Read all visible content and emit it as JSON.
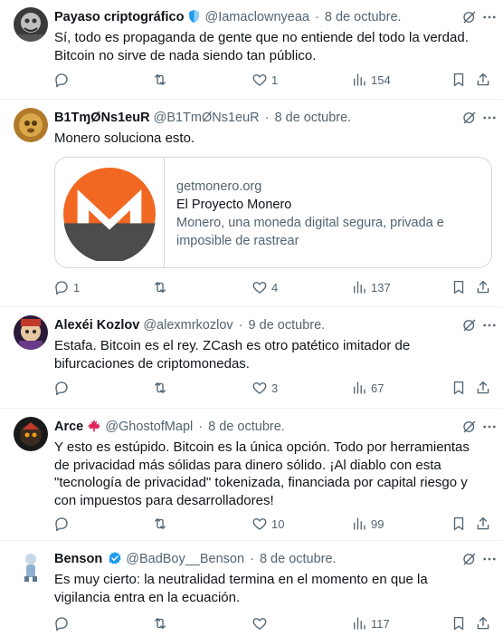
{
  "tweets": [
    {
      "name": "Payaso criptográfico",
      "handle": "@Iamaclownyeaa",
      "date": "8 de octubre.",
      "text": "Sí, todo es propaganda de gente que no entiende del todo la verdad. Bitcoin no sirve de nada siendo tan público.",
      "replies": "",
      "retweets": "",
      "likes": "1",
      "views": "154",
      "badge": "shield"
    },
    {
      "name": "B1TɱØNs1euR",
      "handle": "@B1TmØNs1euR",
      "date": "8 de octubre.",
      "text": "Monero soluciona esto.",
      "replies": "1",
      "retweets": "",
      "likes": "4",
      "views": "137",
      "card": {
        "domain": "getmonero.org",
        "title": "El Proyecto Monero",
        "description": "Monero, una moneda digital segura, privada e imposible de rastrear"
      }
    },
    {
      "name": "Alexéi Kozlov",
      "handle": "@alexmrkozlov",
      "date": "9 de octubre.",
      "text": "Estafa. Bitcoin es el rey. ZCash es otro patético imitador de bifurcaciones de criptomonedas.",
      "replies": "",
      "retweets": "",
      "likes": "3",
      "views": "67"
    },
    {
      "name": "Arce",
      "handle": "@GhostofMapl",
      "date": "8 de octubre.",
      "text": "Y esto es estúpido. Bitcoin es la única opción. Todo por herramientas de privacidad más sólidas para dinero sólido. ¡Al diablo con esta \"tecnología de privacidad\" tokenizada, financiada por capital riesgo y con impuestos para desarrolladores!",
      "replies": "",
      "retweets": "",
      "likes": "10",
      "views": "99",
      "badge": "maple-leaf"
    },
    {
      "name": "Benson",
      "handle": "@BadBoy__Benson",
      "date": "8 de octubre.",
      "text": "Es muy cierto: la neutralidad termina en el momento en que la vigilancia entra en la ecuación.",
      "replies": "",
      "retweets": "",
      "likes": "",
      "views": "117",
      "badge": "verified"
    }
  ],
  "separator": "·",
  "colors": {
    "text": "#0f1419",
    "secondary": "#536471",
    "border": "#eff3f4",
    "verified": "#1d9bf0",
    "monero_orange": "#f26822",
    "monero_gray": "#4c4c4c"
  }
}
